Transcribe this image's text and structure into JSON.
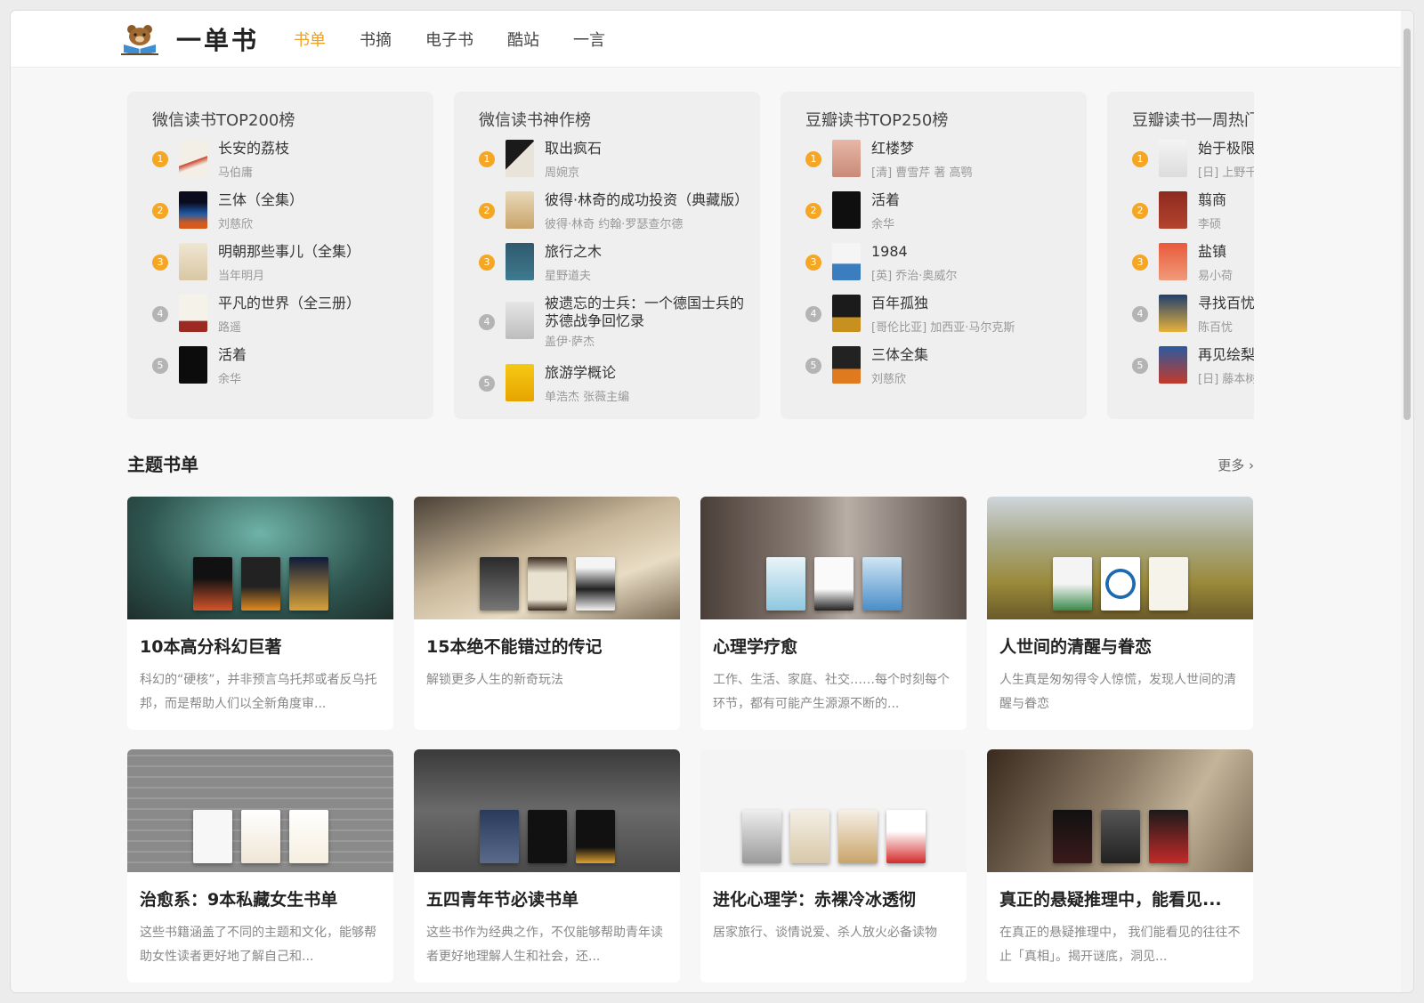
{
  "brand": {
    "name": "一单书"
  },
  "nav": [
    {
      "label": "书单",
      "active": true
    },
    {
      "label": "书摘"
    },
    {
      "label": "电子书"
    },
    {
      "label": "酷站"
    },
    {
      "label": "一言"
    }
  ],
  "rankings": [
    {
      "title": "微信读书TOP200榜",
      "items": [
        {
          "rank": "1",
          "name": "长安的荔枝",
          "author": "马伯庸"
        },
        {
          "rank": "2",
          "name": "三体（全集）",
          "author": "刘慈欣"
        },
        {
          "rank": "3",
          "name": "明朝那些事儿（全集）",
          "author": "当年明月"
        },
        {
          "rank": "4",
          "name": "平凡的世界（全三册）",
          "author": "路遥"
        },
        {
          "rank": "5",
          "name": "活着",
          "author": "余华"
        }
      ]
    },
    {
      "title": "微信读书神作榜",
      "items": [
        {
          "rank": "1",
          "name": "取出疯石",
          "author": "周婉京"
        },
        {
          "rank": "2",
          "name": "彼得·林奇的成功投资（典藏版）",
          "author": "彼得·林奇 约翰·罗瑟查尔德"
        },
        {
          "rank": "3",
          "name": "旅行之木",
          "author": "星野道夫"
        },
        {
          "rank": "4",
          "name": "被遗忘的士兵：一个德国士兵的",
          "name2": "苏德战争回忆录",
          "author": "盖伊·萨杰"
        },
        {
          "rank": "5",
          "name": "旅游学概论",
          "author": "单浩杰 张薇主编"
        }
      ]
    },
    {
      "title": "豆瓣读书TOP250榜",
      "items": [
        {
          "rank": "1",
          "name": "红楼梦",
          "author": "[清] 曹雪芹 著 高鹗"
        },
        {
          "rank": "2",
          "name": "活着",
          "author": "余华"
        },
        {
          "rank": "3",
          "name": "1984",
          "author": "[英] 乔治·奥威尔"
        },
        {
          "rank": "4",
          "name": "百年孤独",
          "author": "[哥伦比亚] 加西亚·马尔克斯"
        },
        {
          "rank": "5",
          "name": "三体全集",
          "author": "刘慈欣"
        }
      ]
    },
    {
      "title": "豆瓣读书一周热门",
      "items": [
        {
          "rank": "1",
          "name": "始于极限",
          "author": "[日] 上野千"
        },
        {
          "rank": "2",
          "name": "翦商",
          "author": "李硕"
        },
        {
          "rank": "3",
          "name": "盐镇",
          "author": "易小荷"
        },
        {
          "rank": "4",
          "name": "寻找百忧",
          "author": "陈百忧"
        },
        {
          "rank": "5",
          "name": "再见绘梨",
          "author": "[日] 藤本树"
        }
      ]
    }
  ],
  "themes_section": {
    "title": "主题书单",
    "more": "更多 ›"
  },
  "themes": [
    {
      "title": "10本高分科幻巨著",
      "desc": "科幻的“硬核”，并非预言乌托邦或者反乌托邦，而是帮助人们以全新角度审...",
      "bg": "#3b6b66"
    },
    {
      "title": "15本绝不能错过的传记",
      "desc": "解锁更多人生的新奇玩法",
      "bg": "#8c7d6a"
    },
    {
      "title": "心理学疗愈",
      "desc": "工作、生活、家庭、社交……每个时刻每个环节，都有可能产生源源不断的...",
      "bg": "#6f6560"
    },
    {
      "title": "人世间的清醒与眷恋",
      "desc": "人生真是匆匆得令人惊慌，发现人世间的清醒与眷恋",
      "bg": "#9a9a6a"
    },
    {
      "title": "治愈系：9本私藏女生书单",
      "desc": "这些书籍涵盖了不同的主题和文化，能够帮助女性读者更好地了解自己和...",
      "bg": "#8e8e8e"
    },
    {
      "title": "五四青年节必读书单",
      "desc": "这些书作为经典之作，不仅能够帮助青年读者更好地理解人生和社会，还...",
      "bg": "#5b5b5b"
    },
    {
      "title": "进化心理学：赤裸冷冰透彻",
      "desc": "居家旅行、谈情说爱、杀人放火必备读物",
      "bg": "#f4f4f4"
    },
    {
      "title": "真正的悬疑推理中，能看见...",
      "desc": "在真正的悬疑推理中， 我们能看见的往往不止「真相」。揭开谜底，洞见...",
      "bg": "#7a6a55"
    }
  ],
  "colors": {
    "accent": "#f0a020",
    "rank_top": "#f5a623",
    "rank_low": "#b4b4b4"
  }
}
